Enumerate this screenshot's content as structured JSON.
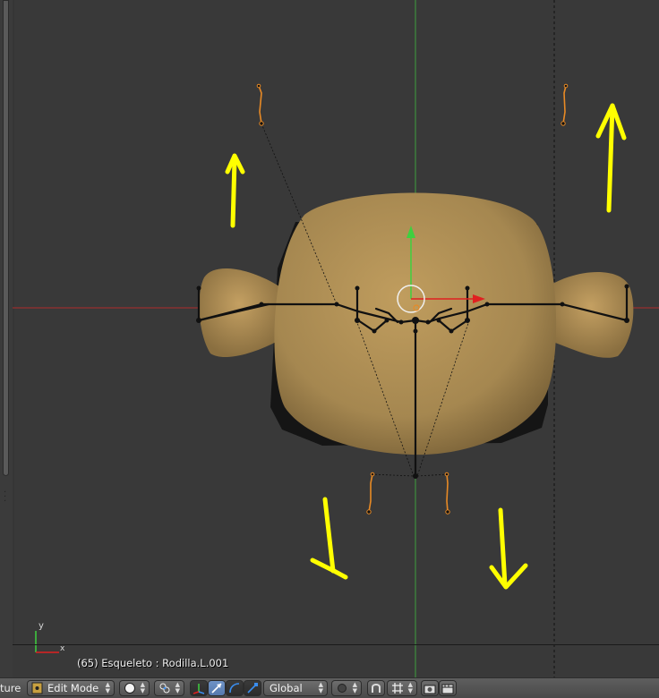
{
  "viewport": {
    "status_text": "(65) Esqueleto : Rodilla.L.001",
    "axis_y_label": "y",
    "axis_x_label": "x",
    "colors": {
      "background": "#393939",
      "x_axis": "#b02a2a",
      "y_axis": "#3fa03f",
      "mesh": "#a58750",
      "annotation_arrows": "#ffff00",
      "selected_bones": "#e88a25"
    },
    "annotation": {
      "arrows": [
        "up",
        "up",
        "down",
        "down"
      ]
    }
  },
  "header": {
    "editor_label_fragment": "ture",
    "mode_select": "Edit Mode",
    "orientation_select": "Global",
    "icons": [
      "editor-type-icon",
      "shading-solid-icon",
      "pivot-point-icon",
      "manipulator-toggle-icon",
      "translate-manipulator-icon",
      "rotate-manipulator-icon",
      "scale-manipulator-icon",
      "proportional-edit-icon",
      "snap-icon",
      "snap-target-icon",
      "render-still-icon",
      "render-animation-icon"
    ]
  }
}
